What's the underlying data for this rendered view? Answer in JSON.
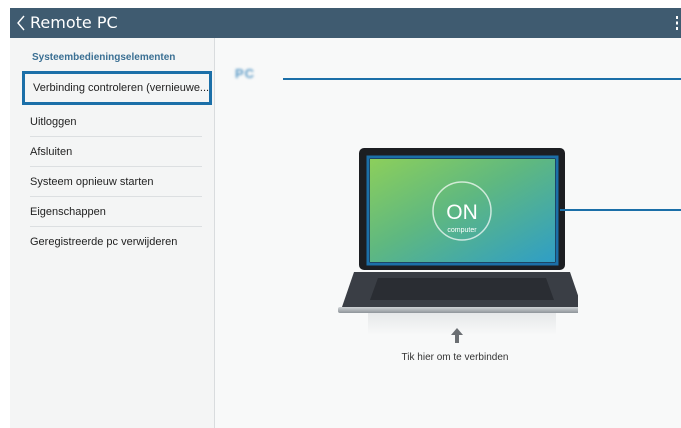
{
  "app": {
    "title": "Remote PC",
    "back_icon": "chevron-left-icon",
    "overflow_icon": "more-vertical-icon"
  },
  "sidebar": {
    "header": "Systeembedieningselementen",
    "items": [
      {
        "label": "Verbinding controleren (vernieuwe..."
      },
      {
        "label": "Uitloggen"
      },
      {
        "label": "Afsluiten"
      },
      {
        "label": "Systeem opnieuw starten"
      },
      {
        "label": "Eigenschappen"
      },
      {
        "label": "Geregistreerde pc verwijderen"
      }
    ]
  },
  "main": {
    "section_label": "PC",
    "screen_status": "ON",
    "screen_subtitle": "computer",
    "hint": "Tik hier om te verbinden",
    "hint_icon": "arrow-up-icon"
  },
  "colors": {
    "actionbar": "#3f5b70",
    "accent": "#1b6fa8",
    "screen_green": "#6fbf73",
    "screen_teal": "#2f9ec6"
  }
}
